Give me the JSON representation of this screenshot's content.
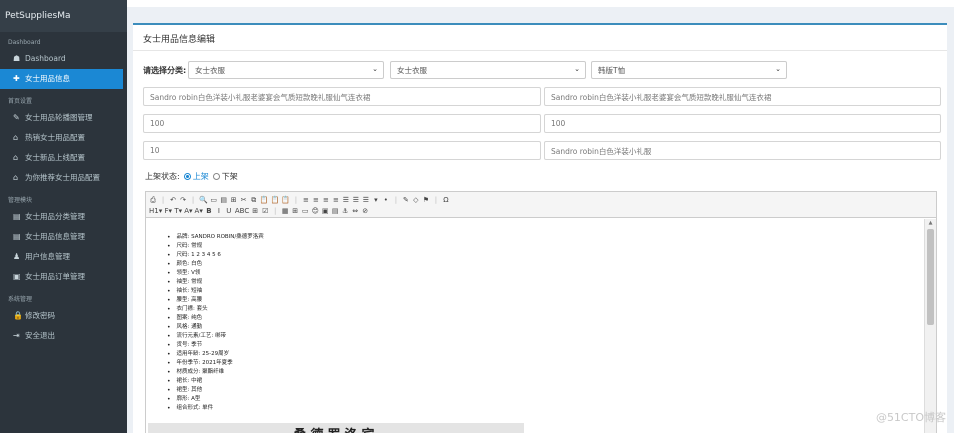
{
  "app": {
    "brand": "PetSuppliesMa"
  },
  "sidebar": {
    "sections": [
      {
        "title": "Dashboard",
        "items": [
          {
            "icon": "dashboard-icon",
            "glyph": "☗",
            "label": "Dashboard",
            "active": false
          },
          {
            "icon": "plus-icon",
            "glyph": "✚",
            "label": "女士用品信息",
            "active": true
          }
        ]
      },
      {
        "title": "首页设置",
        "items": [
          {
            "icon": "edit-icon",
            "glyph": "✎",
            "label": "女士用品轮播图管理",
            "active": false
          },
          {
            "icon": "tag-icon",
            "glyph": "⌂",
            "label": "热销女士用品配置",
            "active": false
          },
          {
            "icon": "tag-icon",
            "glyph": "⌂",
            "label": "女士新品上线配置",
            "active": false
          },
          {
            "icon": "tag-icon",
            "glyph": "⌂",
            "label": "为你推荐女士用品配置",
            "active": false
          }
        ]
      },
      {
        "title": "管理模块",
        "items": [
          {
            "icon": "list-icon",
            "glyph": "▤",
            "label": "女士用品分类管理",
            "active": false
          },
          {
            "icon": "list-icon",
            "glyph": "▤",
            "label": "女士用品信息管理",
            "active": false
          },
          {
            "icon": "users-icon",
            "glyph": "♟",
            "label": "用户信息管理",
            "active": false
          },
          {
            "icon": "order-icon",
            "glyph": "▣",
            "label": "女士用品订单管理",
            "active": false
          }
        ]
      },
      {
        "title": "系统管理",
        "items": [
          {
            "icon": "lock-icon",
            "glyph": "🔒",
            "label": "修改密码",
            "active": false
          },
          {
            "icon": "logout-icon",
            "glyph": "⇥",
            "label": "安全退出",
            "active": false
          }
        ]
      }
    ]
  },
  "form": {
    "title": "女士用品信息编辑",
    "category_label": "请选择分类:",
    "category1": "女士衣服",
    "category2": "女士衣服",
    "category3": "韩版T恤",
    "name": "Sandro robin白色洋装小礼服老婆宴会气质短款晚礼服仙气连衣裙",
    "intro": "Sandro robin白色洋装小礼服老婆宴会气质短款晚礼服仙气连衣裙",
    "original_price": "100",
    "selling_price": "100",
    "stock": "10",
    "tag": "Sandro robin白色洋装小礼服",
    "status_label": "上架状态:",
    "status_on": "上架",
    "status_off": "下架"
  },
  "editor": {
    "toolbar_row1": [
      "⎙",
      "|",
      "↶",
      "↷",
      "|",
      "🔍",
      "▭",
      "▤",
      "⊞",
      "✂",
      "⧉",
      "📋",
      "📋",
      "📋",
      "|",
      "≡",
      "≡",
      "≡",
      "≡",
      "☰",
      "☰",
      "☰",
      "▾",
      "•",
      "|",
      "✎",
      "◇",
      "⚑",
      "|",
      "Ω"
    ],
    "toolbar_row2": [
      "H1▾",
      "F▾",
      "T▾",
      "A▾",
      "A▾",
      "B",
      "I",
      "U",
      "ABC",
      "⊞",
      "☑",
      "|",
      "▦",
      "⊞",
      "▭",
      "😊",
      "▣",
      "▤",
      "⚓",
      "⇔",
      "⊘"
    ],
    "items": [
      "品牌: SANDRO ROBIN/桑德罗洛宾",
      "尺码: 常规",
      "尺码: 1 2 3 4 5 6",
      "颜色: 白色",
      "领型: V领",
      "袖型: 常规",
      "袖长: 短袖",
      "腰型: 高腰",
      "衣门襟: 套头",
      "图案: 纯色",
      "风格: 通勤",
      "流行元素/工艺: 绑带",
      "货号: 季节",
      "适用年龄: 25-29周岁",
      "年份季节: 2021年夏季",
      "材质成分: 聚酯纤维",
      "裙长: 中裙",
      "裙型: 其他",
      "廓形: A型",
      "组合形式: 单件"
    ],
    "banner": "桑德罗洛宾"
  },
  "watermark": "@51CTO博客"
}
